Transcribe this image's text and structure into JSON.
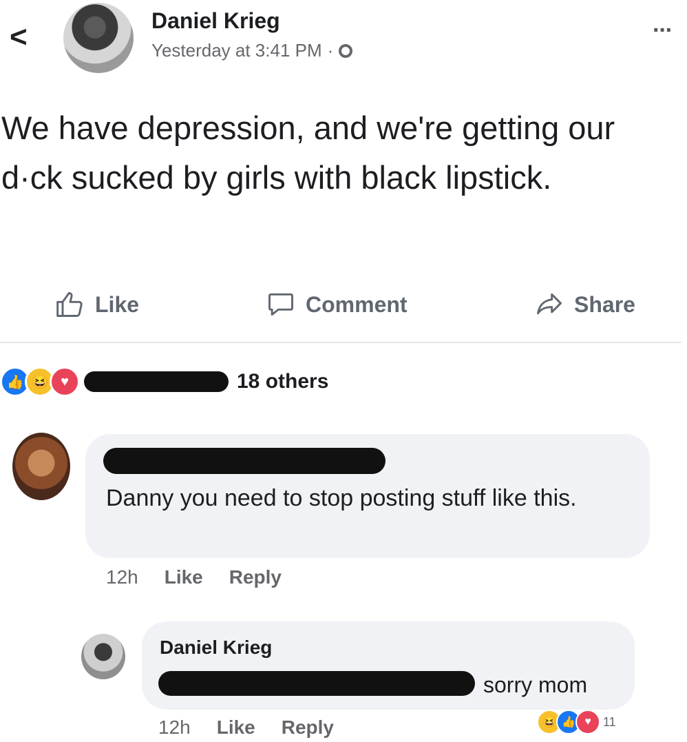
{
  "header": {
    "back_label": "<",
    "author": "Daniel Krieg",
    "timestamp": "Yesterday at 3:41 PM",
    "separator": "·",
    "more_label": "···"
  },
  "post": {
    "text": "We have depression, and we're getting our d·ck sucked by girls with black lipstick."
  },
  "actions": {
    "like": "Like",
    "comment": "Comment",
    "share": "Share"
  },
  "reactions": {
    "others_label": "18 others",
    "icons": [
      "like-icon",
      "haha-icon",
      "love-icon"
    ]
  },
  "comments": [
    {
      "text": "Danny you need to stop posting stuff like this.",
      "time": "12h",
      "like": "Like",
      "reply": "Reply"
    }
  ],
  "reply": {
    "author": "Daniel Krieg",
    "text": "sorry mom",
    "time": "12h",
    "like": "Like",
    "reply": "Reply",
    "reaction_count": "11"
  },
  "colors": {
    "like_blue": "#1877f2",
    "haha_yellow": "#f7c12b",
    "love_red": "#e9435a",
    "bubble_gray": "#f0f2f5",
    "meta_gray": "#65676b"
  }
}
